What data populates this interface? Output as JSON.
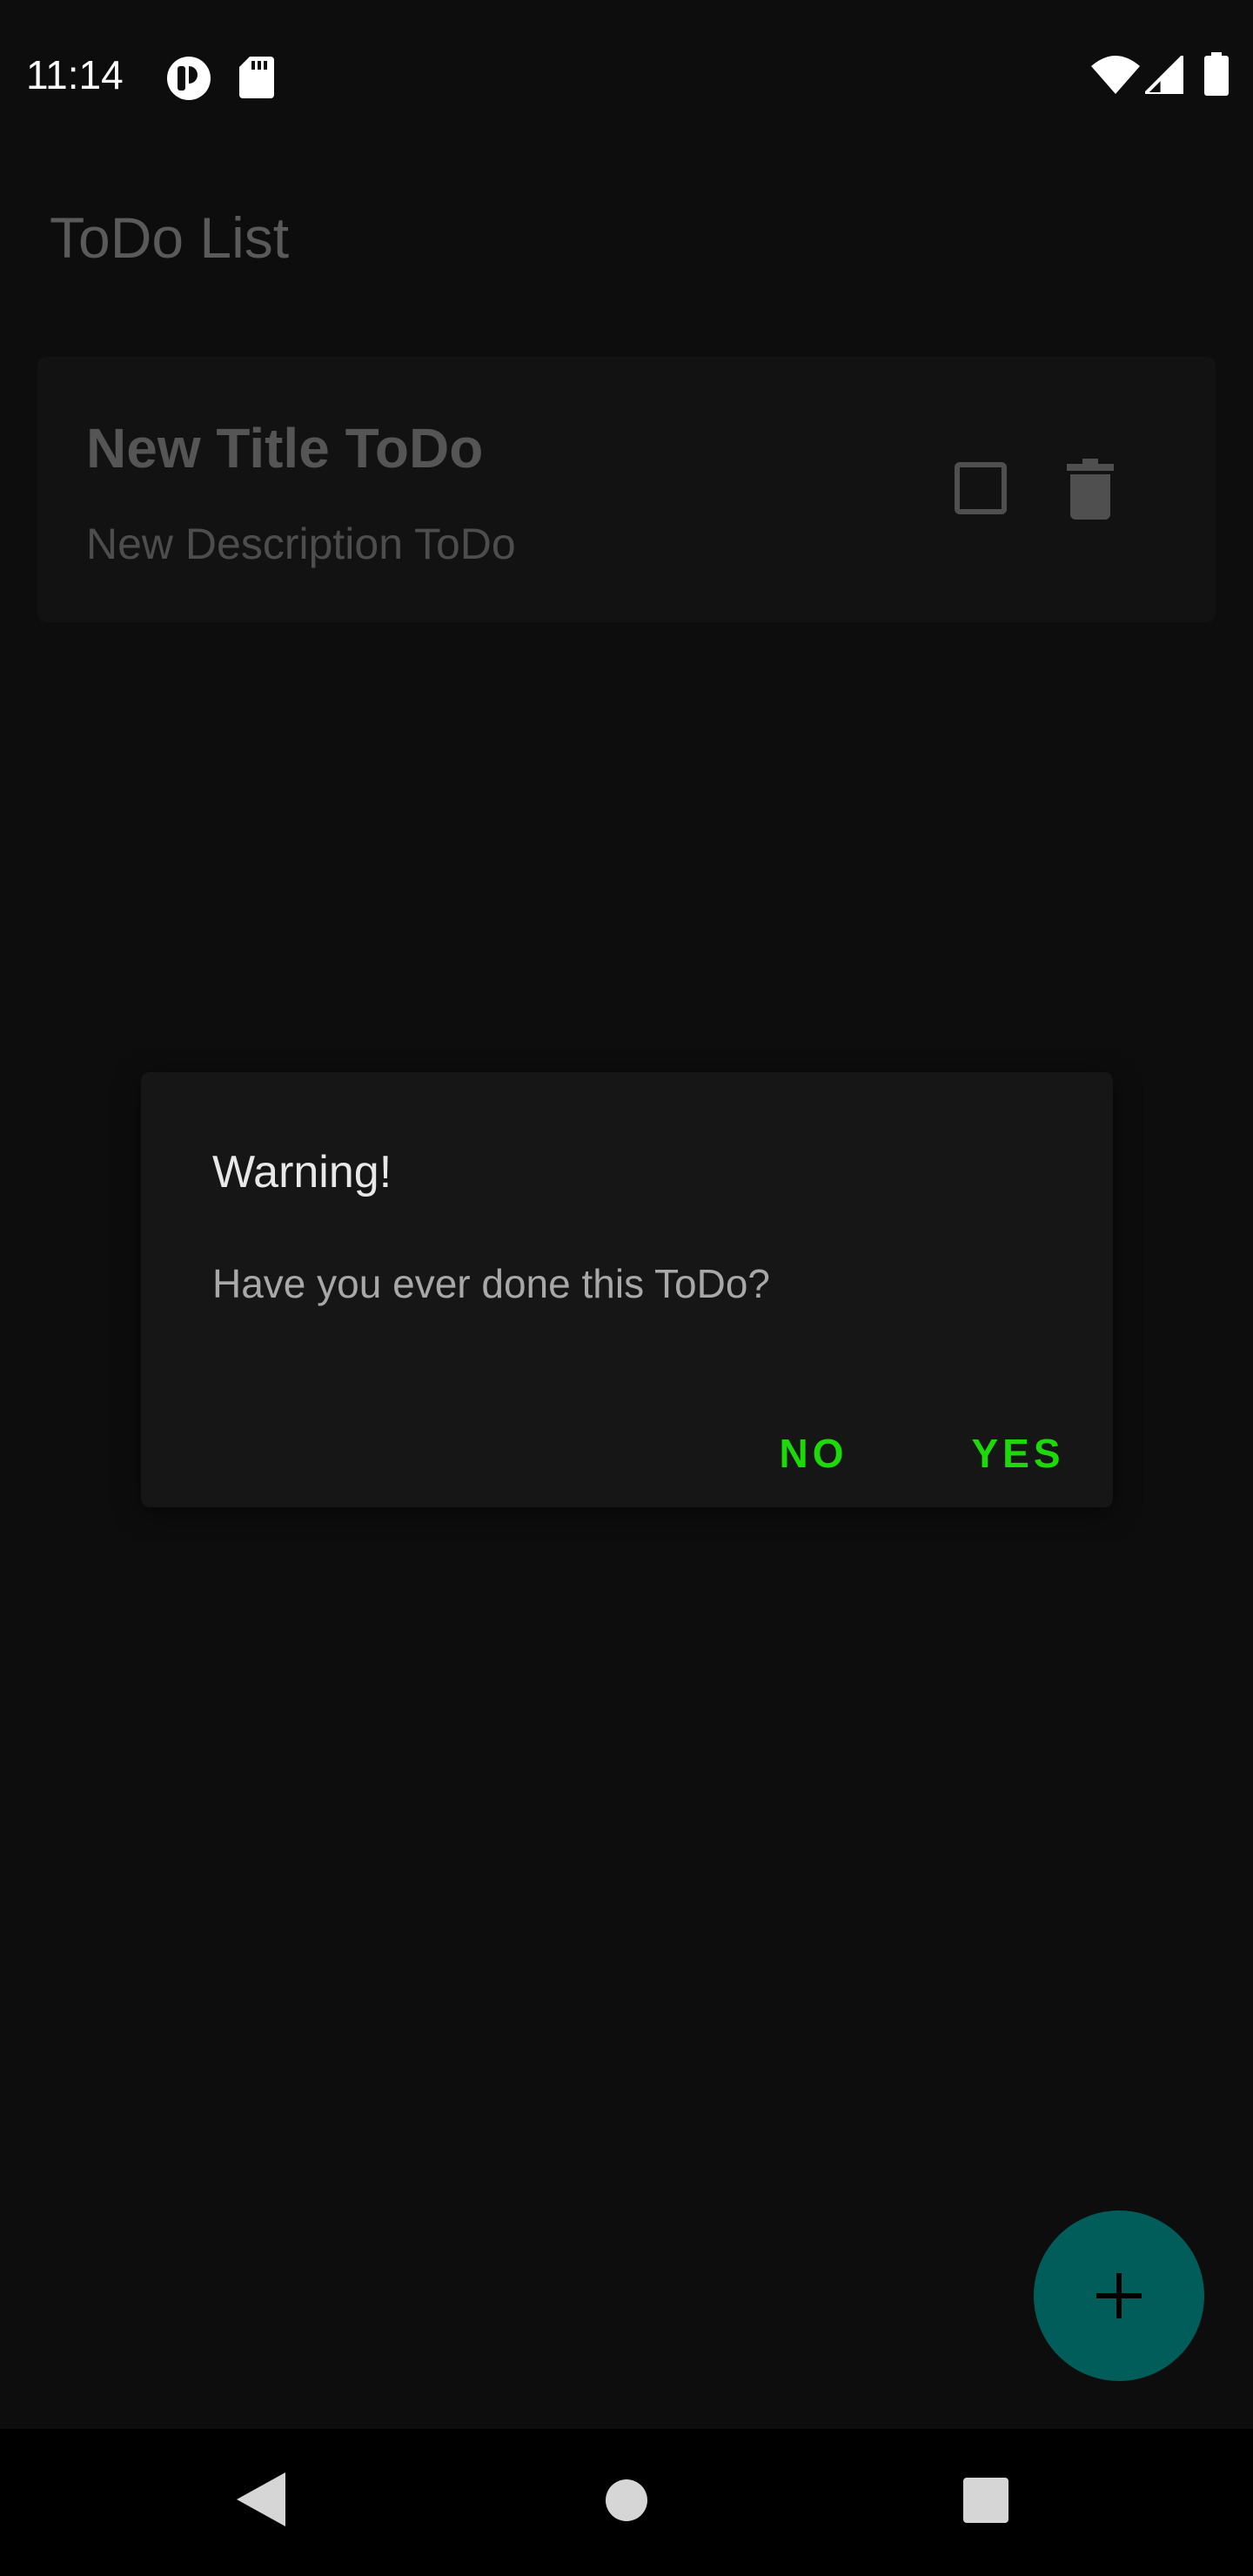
{
  "status_bar": {
    "time": "11:14",
    "left_icons": [
      "sync-icon",
      "sd-card-icon"
    ],
    "right_icons": [
      "wifi-icon",
      "cell-signal-icon",
      "battery-icon"
    ]
  },
  "app_bar": {
    "title": "ToDo List"
  },
  "todo_list": {
    "items": [
      {
        "title": "New Title ToDo",
        "description": "New Description ToDo",
        "checked": false
      }
    ]
  },
  "dialog": {
    "title": "Warning!",
    "message": "Have you ever done this ToDo?",
    "negative_label": "NO",
    "positive_label": "YES",
    "accent_color": "#1ed90a"
  },
  "fab": {
    "icon": "plus-icon",
    "color": "#015d5a"
  },
  "nav_bar": {
    "icons": [
      "back-icon",
      "home-icon",
      "recents-icon"
    ]
  }
}
